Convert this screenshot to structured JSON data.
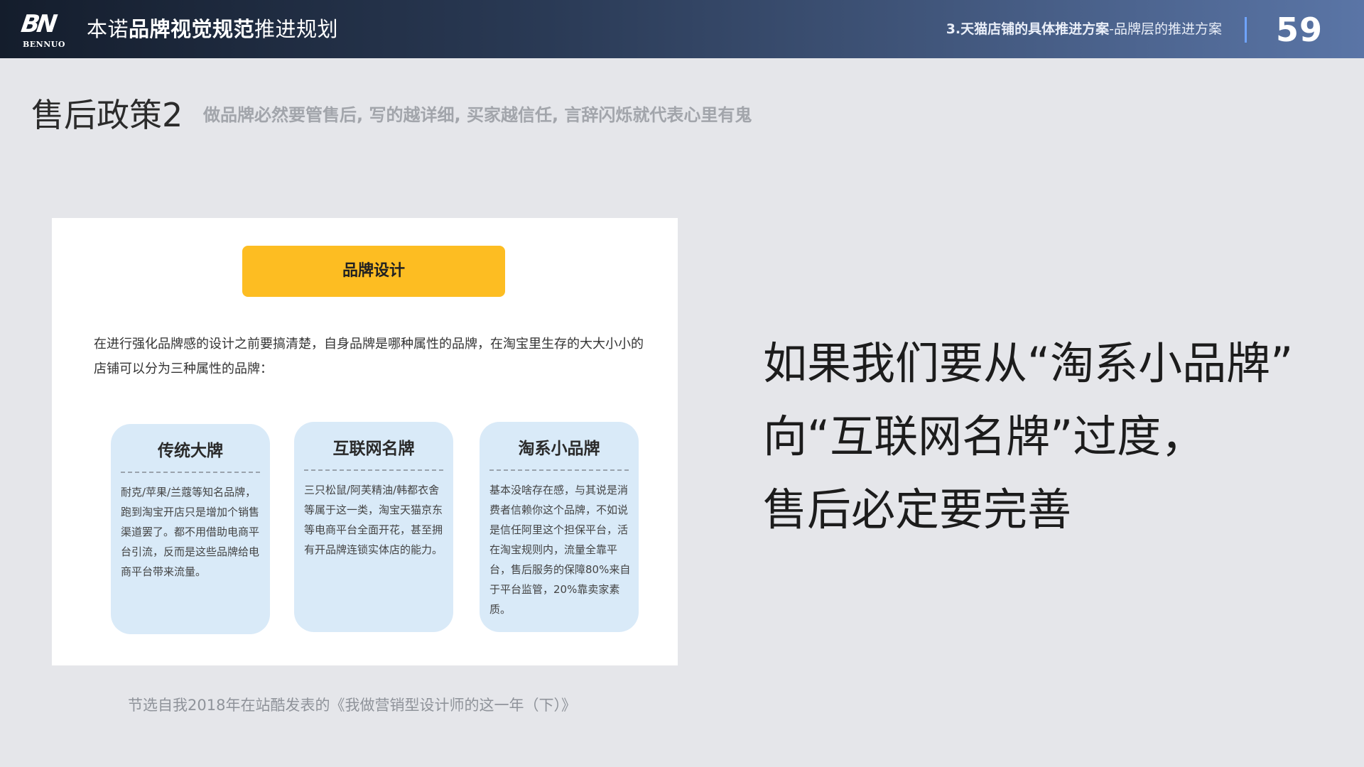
{
  "header": {
    "logo_mark": "BN",
    "logo_text": "BENNUO",
    "title_prefix": "本诺",
    "title_bold": "品牌视觉规范",
    "title_suffix": "推进规划",
    "section_bold": "3.天猫店铺的具体推进方案",
    "section_rest": "-品牌层的推进方案",
    "page_number": "59",
    "divider_color": "#6fa4ff"
  },
  "page": {
    "title": "售后政策2",
    "subtitle": "做品牌必然要管售后, 写的越详细, 买家越信任, 言辞闪烁就代表心里有鬼"
  },
  "card": {
    "pill_label": "品牌设计",
    "pill_color": "#fdbd22",
    "intro": "在进行强化品牌感的设计之前要搞清楚，自身品牌是哪种属性的品牌，在淘宝里生存的大大小小的店铺可以分为三种属性的品牌：",
    "boxes": [
      {
        "title": "传统大牌",
        "body": "耐克/苹果/兰蔻等知名品牌，跑到淘宝开店只是增加个销售渠道罢了。都不用借助电商平台引流，反而是这些品牌给电商平台带来流量。"
      },
      {
        "title": "互联网名牌",
        "body": "三只松鼠/阿芙精油/韩都衣舍等属于这一类，淘宝天猫京东等电商平台全面开花，甚至拥有开品牌连锁实体店的能力。"
      },
      {
        "title": "淘系小品牌",
        "body": "基本没啥存在感，与其说是消费者信赖你这个品牌，不如说是信任阿里这个担保平台，活在淘宝规则内，流量全靠平台，售后服务的保障80%来自于平台监管，20%靠卖家素质。"
      }
    ],
    "box_color": "#d9eaf8"
  },
  "caption": "节选自我2018年在站酷发表的《我做营销型设计师的这一年（下）》",
  "statement": {
    "line1": "如果我们要从“淘系小品牌”",
    "line2": "向“互联网名牌”过度，",
    "line3": "售后必定要完善"
  }
}
